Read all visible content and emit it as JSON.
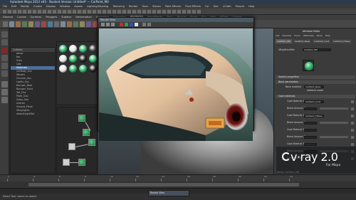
{
  "window": {
    "title": "Autodesk Maya 2012 x64 - Student Version: Untitled*  ---  CarPaint_Mtl"
  },
  "menubar": [
    "File",
    "Edit",
    "Modify",
    "Create",
    "Display",
    "Window",
    "Assets",
    "Lighting/Shading",
    "Texturing",
    "Render",
    "Toon",
    "Stereo",
    "Paint Effects",
    "Fluid Effects",
    "Fur",
    "Hair",
    "nCloth",
    "Muscle",
    "Help"
  ],
  "shelf_tabs": [
    "General",
    "Curves",
    "Surfaces",
    "Polygons",
    "Subdivs",
    "Deformation",
    "Animation",
    "Dynamics",
    "Rendering",
    "PaintEffects",
    "Toon",
    "Muscle",
    "Fluids",
    "Fur",
    "Hair",
    "nCloth",
    "Custom"
  ],
  "outliner": {
    "header": "Outliner",
    "rows": [
      "persp",
      "top",
      "front",
      "side",
      "Materials",
      "CarBody_Grp",
      "Wheels",
      "Chrome_Grp",
      "Lights_Grp",
      "Bumper_Rear",
      "Bumper_Front",
      "Tail_Fins",
      "Plate_Geo",
      "Glass_Geo",
      "Interior",
      "Ground_Plane",
      "VRayLight1",
      "defaultLightSet"
    ]
  },
  "render_window": {
    "title": "Render View"
  },
  "attribute_editor": {
    "title": "Attribute Editor",
    "tabs": [
      "List",
      "Selected",
      "Focus",
      "Attributes",
      "Show",
      "Help"
    ],
    "node_tabs": [
      "CarPaint_Mtl",
      "CarPaint_Base",
      "CarPaint_Coat",
      "CarPaint_Flakes"
    ],
    "shader_label": "VRayBlendMtl:",
    "shader_value": "CarPaint_Mtl",
    "sections": [
      "Swatch properties",
      "Basic parameters",
      "Coat materials"
    ],
    "base_material_label": "Base material",
    "base_material_value": "CarPaint_Base",
    "additive_label": "Additive mode",
    "coat_rows": [
      {
        "label": "Coat Material 0",
        "value": "CarPaint_Coat"
      },
      {
        "label": "Blend Amount 0",
        "value": ""
      },
      {
        "label": "Coat Material 1",
        "value": "CarPaint_Flakes"
      },
      {
        "label": "Blend Amount 1",
        "value": ""
      },
      {
        "label": "Coat Material 2",
        "value": ""
      },
      {
        "label": "Blend Amount 2",
        "value": ""
      },
      {
        "label": "Coat Material 3",
        "value": ""
      },
      {
        "label": "Blend Amount 3",
        "value": ""
      },
      {
        "label": "Coat Material 4",
        "value": ""
      }
    ],
    "notes_label": "Notes: CarPaint_Mtl"
  },
  "vray": {
    "brand": "v·ray 2.0",
    "subtitle": "For Maya"
  },
  "timeline": {
    "ticks": [
      "2",
      "4",
      "6",
      "8",
      "10",
      "12",
      "14",
      "16",
      "18",
      "20",
      "22",
      "24"
    ]
  },
  "help_line": "Select Tool: select an object",
  "taskbar_item": "Render View",
  "colors": {
    "accent": "#4f6f9a",
    "title_bar": "#2d3c4c",
    "green_swatch": "#2fb36a"
  }
}
